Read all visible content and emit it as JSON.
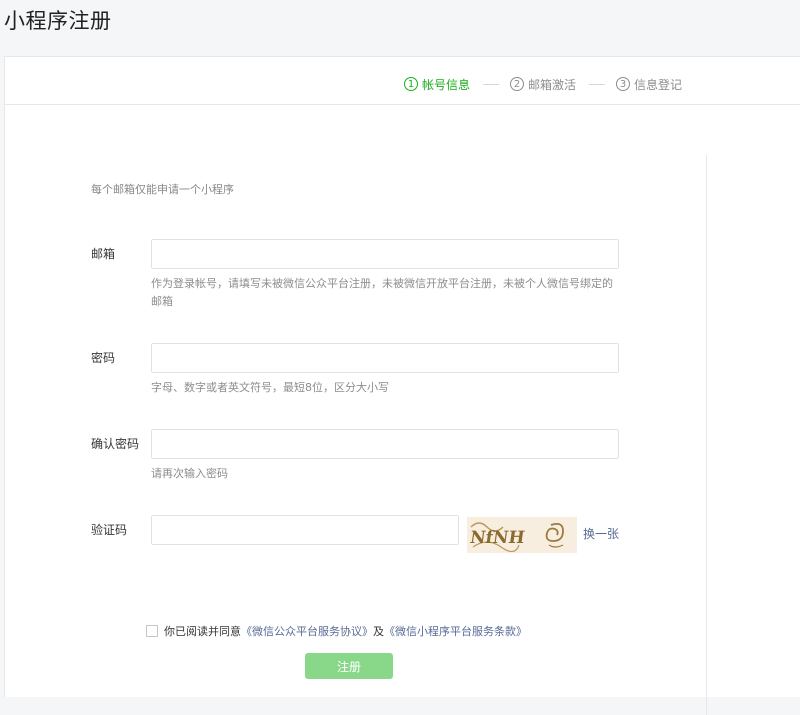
{
  "page": {
    "title": "小程序注册"
  },
  "steps": [
    {
      "num": "1",
      "label": "帐号信息"
    },
    {
      "num": "2",
      "label": "邮箱激活"
    },
    {
      "num": "3",
      "label": "信息登记"
    }
  ],
  "form": {
    "notice": "每个邮箱仅能申请一个小程序",
    "email": {
      "label": "邮箱",
      "value": "",
      "help": "作为登录帐号，请填写未被微信公众平台注册，未被微信开放平台注册，未被个人微信号绑定的邮箱"
    },
    "password": {
      "label": "密码",
      "value": "",
      "help": "字母、数字或者英文符号，最短8位，区分大小写"
    },
    "confirm": {
      "label": "确认密码",
      "value": "",
      "help": "请再次输入密码"
    },
    "captcha": {
      "label": "验证码",
      "value": "",
      "refresh_label": "换一张",
      "image_text": "NfNH"
    }
  },
  "agreement": {
    "prefix": "你已阅读并同意",
    "link1": "《微信公众平台服务协议》",
    "and": "及",
    "link2": "《微信小程序平台服务条款》",
    "checked": false
  },
  "submit_label": "注册",
  "colors": {
    "accent": "#1aad19",
    "link": "#576b95",
    "button_disabled": "#89d88a"
  }
}
